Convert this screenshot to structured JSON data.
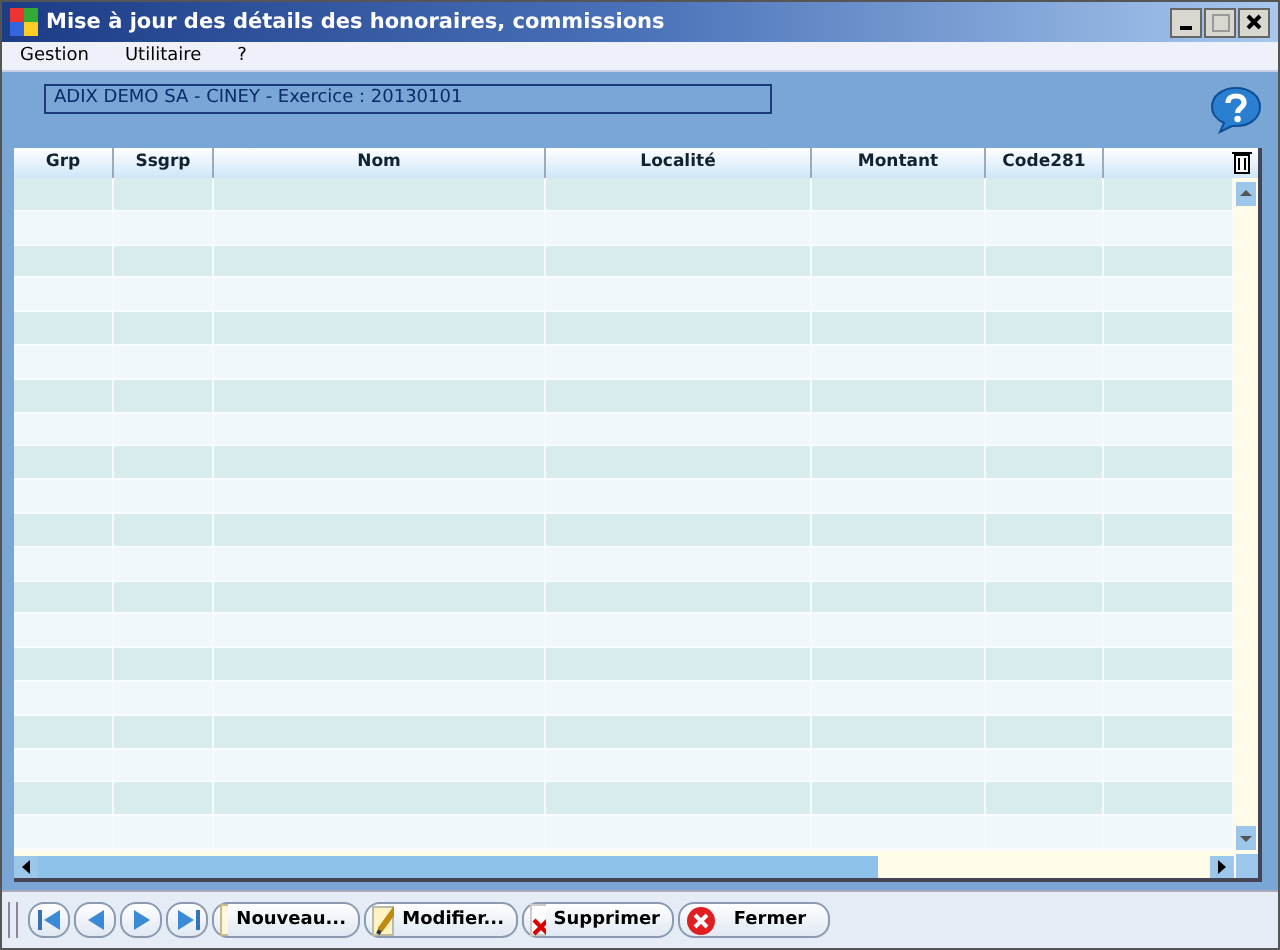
{
  "window": {
    "title": "Mise à jour  des détails des honoraires, commissions"
  },
  "menu": [
    "Gestion",
    "Utilitaire",
    "?"
  ],
  "header_field": {
    "value": "ADIX DEMO SA  - CINEY - Exercice : 20130101"
  },
  "table": {
    "columns": [
      "Grp",
      "Ssgrp",
      "Nom",
      "Localité",
      "Montant",
      "Code281"
    ]
  },
  "buttons": [
    {
      "label": "Nouveau...",
      "kind": "new"
    },
    {
      "label": "Modifier...",
      "kind": "edit"
    },
    {
      "label": "Supprimer",
      "kind": "delete"
    },
    {
      "label": "Fermer",
      "kind": "close"
    }
  ]
}
